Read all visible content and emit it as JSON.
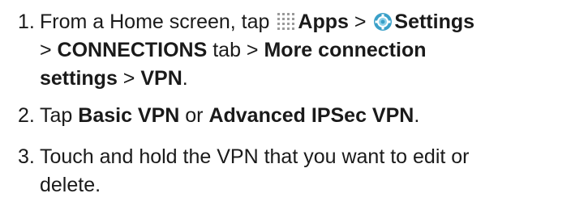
{
  "steps": [
    {
      "number": "1.",
      "line1": {
        "t1": "From a Home screen, tap ",
        "icon1": "apps-grid-icon",
        "b1": "Apps",
        "t2": " > ",
        "icon2": "settings-gear-icon",
        "b2": "Settings"
      },
      "line2": {
        "t1": "> ",
        "b1": "CONNECTIONS",
        "t2": " tab > ",
        "b2": "More connection"
      },
      "line3": {
        "b1": "settings",
        "t1": " > ",
        "b2": "VPN",
        "t2": "."
      }
    },
    {
      "number": "2.",
      "t1": "Tap ",
      "b1": "Basic VPN",
      "t2": " or ",
      "b2": "Advanced IPSec VPN",
      "t3": "."
    },
    {
      "number": "3.",
      "line1": "Touch and hold the VPN that you want to edit or",
      "line2": "delete."
    }
  ],
  "colors": {
    "text": "#1a1a1a",
    "apps_icon": "#9a9a9a",
    "settings_icon_outer": "#3aa0c8",
    "settings_icon_inner": "#8ed2ea"
  }
}
